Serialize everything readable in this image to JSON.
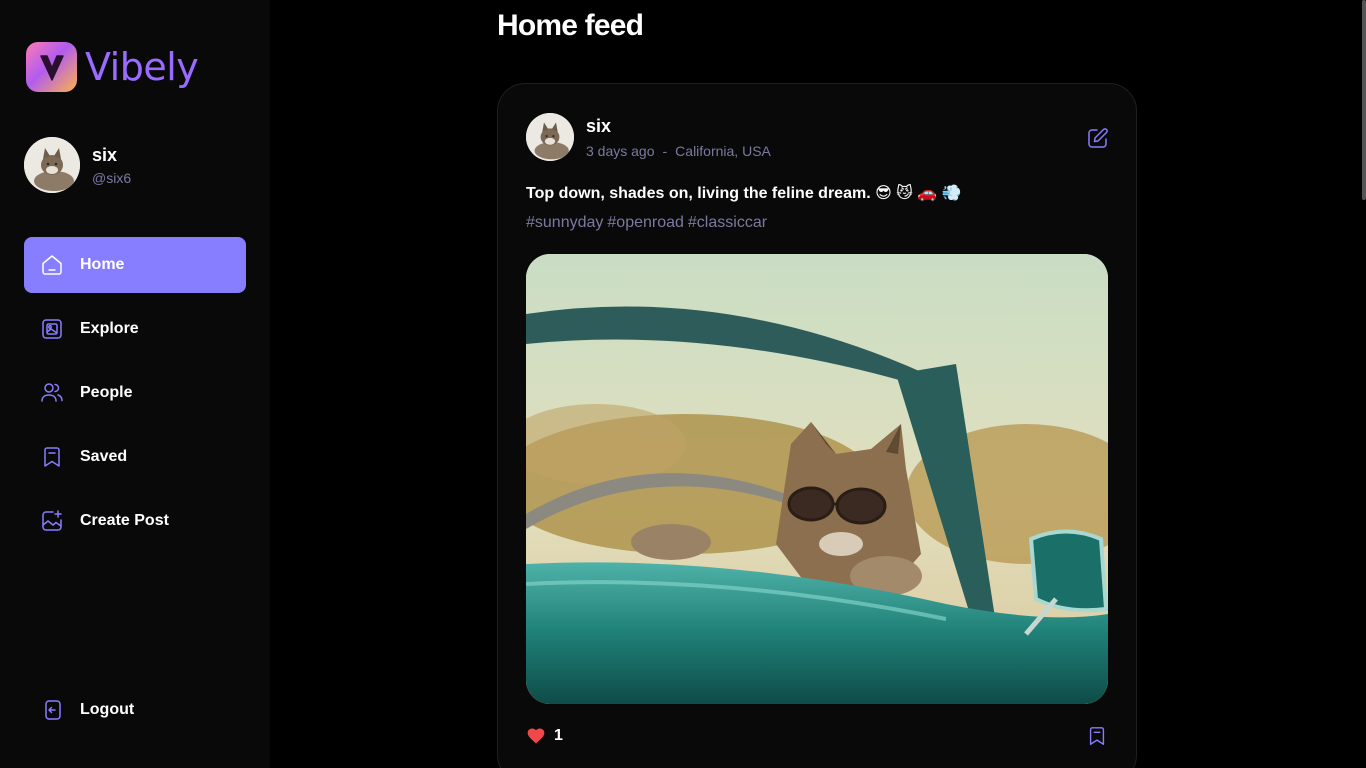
{
  "app": {
    "name": "Vibely",
    "brand_color": "#877eff",
    "muted_color": "#7a7aa0"
  },
  "user": {
    "name": "six",
    "handle": "@six6"
  },
  "nav": {
    "items": [
      {
        "label": "Home",
        "icon": "home-icon",
        "active": true
      },
      {
        "label": "Explore",
        "icon": "gallery-icon",
        "active": false
      },
      {
        "label": "People",
        "icon": "people-icon",
        "active": false
      },
      {
        "label": "Saved",
        "icon": "bookmark-icon",
        "active": false
      },
      {
        "label": "Create Post",
        "icon": "add-image-icon",
        "active": false
      }
    ],
    "logout_label": "Logout"
  },
  "main": {
    "title": "Home feed"
  },
  "post": {
    "author": "six",
    "time": "3 days ago",
    "separator": "-",
    "location": "California, USA",
    "caption": "Top down, shades on, living the feline dream. 😎 😼 🚗 💨",
    "tags": [
      "#sunnyday",
      "#openroad",
      "#classiccar"
    ],
    "likes": "1",
    "liked": true
  }
}
